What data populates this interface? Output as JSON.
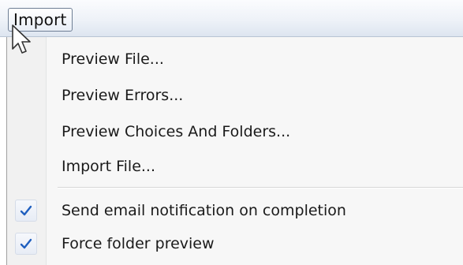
{
  "menubar": {
    "title": "Import"
  },
  "menu": {
    "items": [
      {
        "label": "Preview File...",
        "checked": false
      },
      {
        "label": "Preview Errors...",
        "checked": false
      },
      {
        "label": "Preview Choices And Folders...",
        "checked": false
      },
      {
        "label": "Import File...",
        "checked": false
      },
      {
        "label": "Send email notification on completion",
        "checked": true
      },
      {
        "label": "Force folder preview",
        "checked": true
      }
    ]
  },
  "colors": {
    "check_mark": "#1f5fbf",
    "menu_background": "#f7f7f7",
    "menubar_gradient_bottom": "#dde5f0"
  },
  "icons": {
    "cursor": "arrow-cursor-icon",
    "check": "checkmark-icon"
  }
}
